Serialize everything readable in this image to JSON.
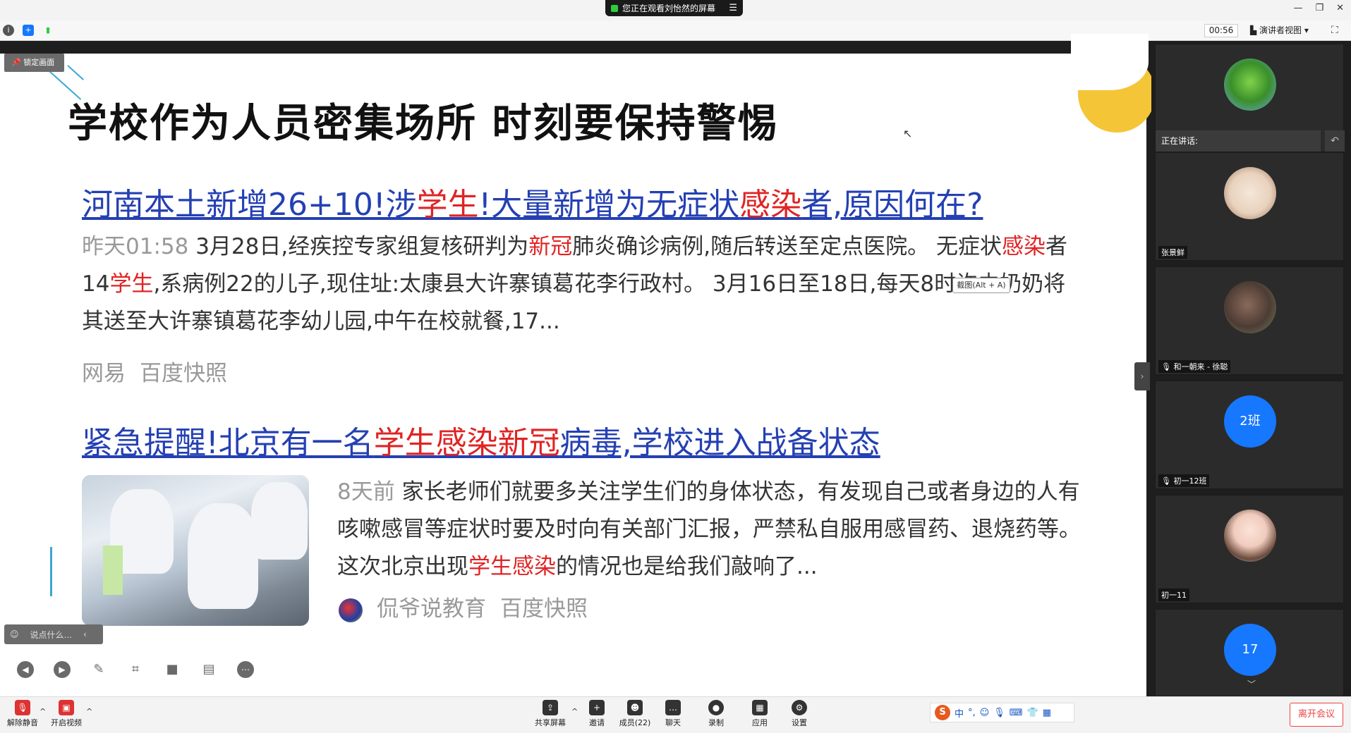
{
  "topbar": {
    "share_banner": "您正在观看刘怡然的屏幕",
    "timer": "00:56",
    "view_mode": "演讲者视图"
  },
  "share": {
    "lock_label": "锁定画面",
    "slide_title": "学校作为人员密集场所  时刻要保持警惕",
    "result1": {
      "title_parts": [
        "河南本土新增26+10!涉",
        "学生",
        "!大量新增为无症状",
        "感染",
        "者,原因何在?"
      ],
      "date": "昨天01:58",
      "snippet_parts": [
        " 3月28日,经疾控专家组复核研判为",
        "新冠",
        "肺炎确诊病例,随后转送至定点医院。 无症状",
        "感染",
        "者14",
        "学生",
        ",系病例22的儿子,现住址:太康县大许寨镇葛花李行政村。 3月16日至18日,每天8时许由奶奶将其送至大许寨镇葛花李幼儿园,中午在校就餐,17..."
      ],
      "source": "网易",
      "snapshot": "百度快照"
    },
    "screenshot_tip": "截图(Alt + A)",
    "result2": {
      "title_parts": [
        "紧急提醒!北京有一名",
        "学生感染新冠",
        "病毒,学校进入战备状态"
      ],
      "date": "8天前",
      "snippet_parts": [
        " 家长老师们就要多关注学生们的身体状态，有发现自己或者身边的人有咳嗽感冒等症状时要及时向有关部门汇报，严禁私自服用感冒药、退烧药等。这次北京出现",
        "学生感染",
        "的情况也是给我们敲响了..."
      ],
      "source": "侃爷说教育",
      "snapshot": "百度快照"
    },
    "chat_placeholder": "说点什么..."
  },
  "participants": {
    "speaking_label": "正在讲话:",
    "tiles": [
      {
        "name": "张景鲜"
      },
      {
        "name": "和一朝来 - 徐聪"
      },
      {
        "name": "初一12班",
        "badge": "2班"
      },
      {
        "name": "初一11"
      },
      {
        "badge": "17"
      }
    ]
  },
  "bottombar": {
    "unmute": "解除静音",
    "start_video": "开启视频",
    "share_screen": "共享屏幕",
    "invite": "邀请",
    "members": "成员(22)",
    "chat": "聊天",
    "record": "录制",
    "apps": "应用",
    "settings": "设置",
    "ime_lang": "中",
    "leave": "离开会议"
  },
  "colors": {
    "link_blue": "#2440b3",
    "highlight_red": "#e02424",
    "accent_yellow": "#f4c536",
    "participant_blue": "#1677ff"
  }
}
